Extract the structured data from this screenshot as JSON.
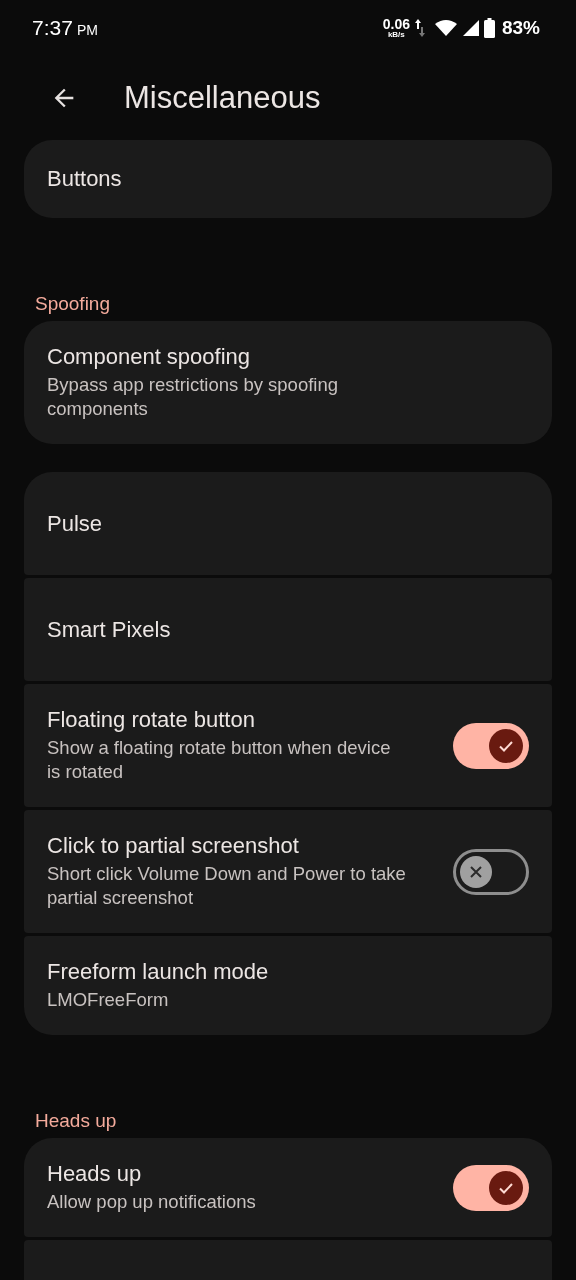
{
  "status_bar": {
    "time": "7:37",
    "ampm": "PM",
    "net_speed": "0.06",
    "net_unit": "kB/s",
    "battery": "83%"
  },
  "header": {
    "title": "Miscellaneous"
  },
  "groups": [
    {
      "items": [
        {
          "kind": "link",
          "title": "Buttons"
        }
      ]
    },
    {
      "header": "Spoofing",
      "items": [
        {
          "kind": "link",
          "title": "Component spoofing",
          "summary": "Bypass app restrictions by spoofing components"
        }
      ]
    },
    {
      "items": [
        {
          "kind": "link",
          "title": "Pulse"
        },
        {
          "kind": "link",
          "title": "Smart Pixels"
        },
        {
          "kind": "switch",
          "title": "Floating rotate button",
          "summary": "Show a floating rotate button when device is rotated",
          "on": true
        },
        {
          "kind": "switch",
          "title": "Click to partial screenshot",
          "summary": "Short click Volume Down and Power to take partial screenshot",
          "on": false
        },
        {
          "kind": "link",
          "title": "Freeform launch mode",
          "summary": "LMOFreeForm"
        }
      ]
    },
    {
      "header": "Heads up",
      "items": [
        {
          "kind": "switch",
          "title": "Heads up",
          "summary": "Allow pop up notifications",
          "on": true
        },
        {
          "kind": "cut-off"
        }
      ]
    }
  ]
}
